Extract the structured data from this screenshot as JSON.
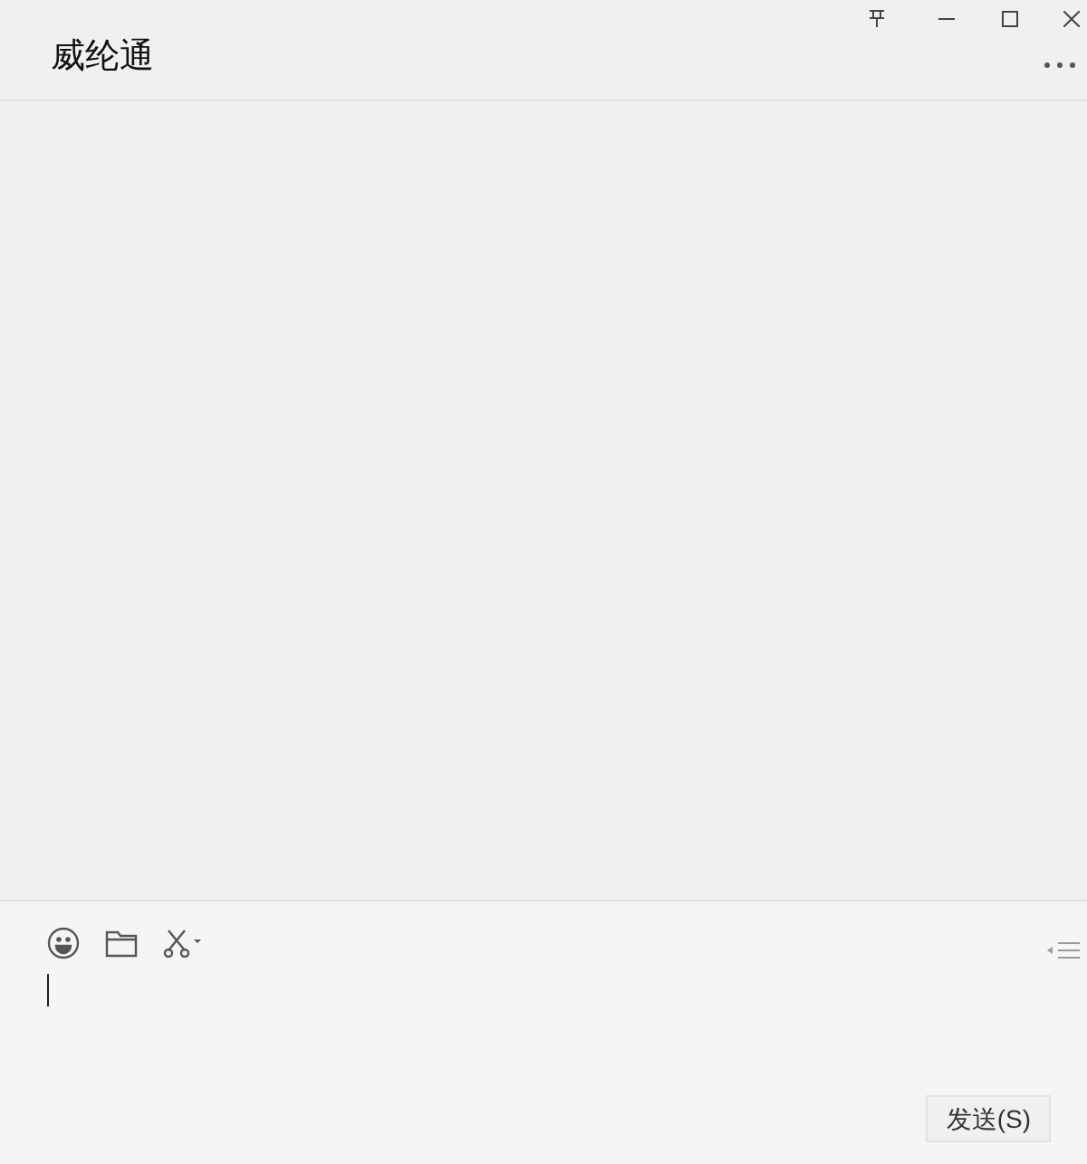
{
  "window": {
    "title": "威纶通"
  },
  "send_button": {
    "label": "发送(S)"
  }
}
